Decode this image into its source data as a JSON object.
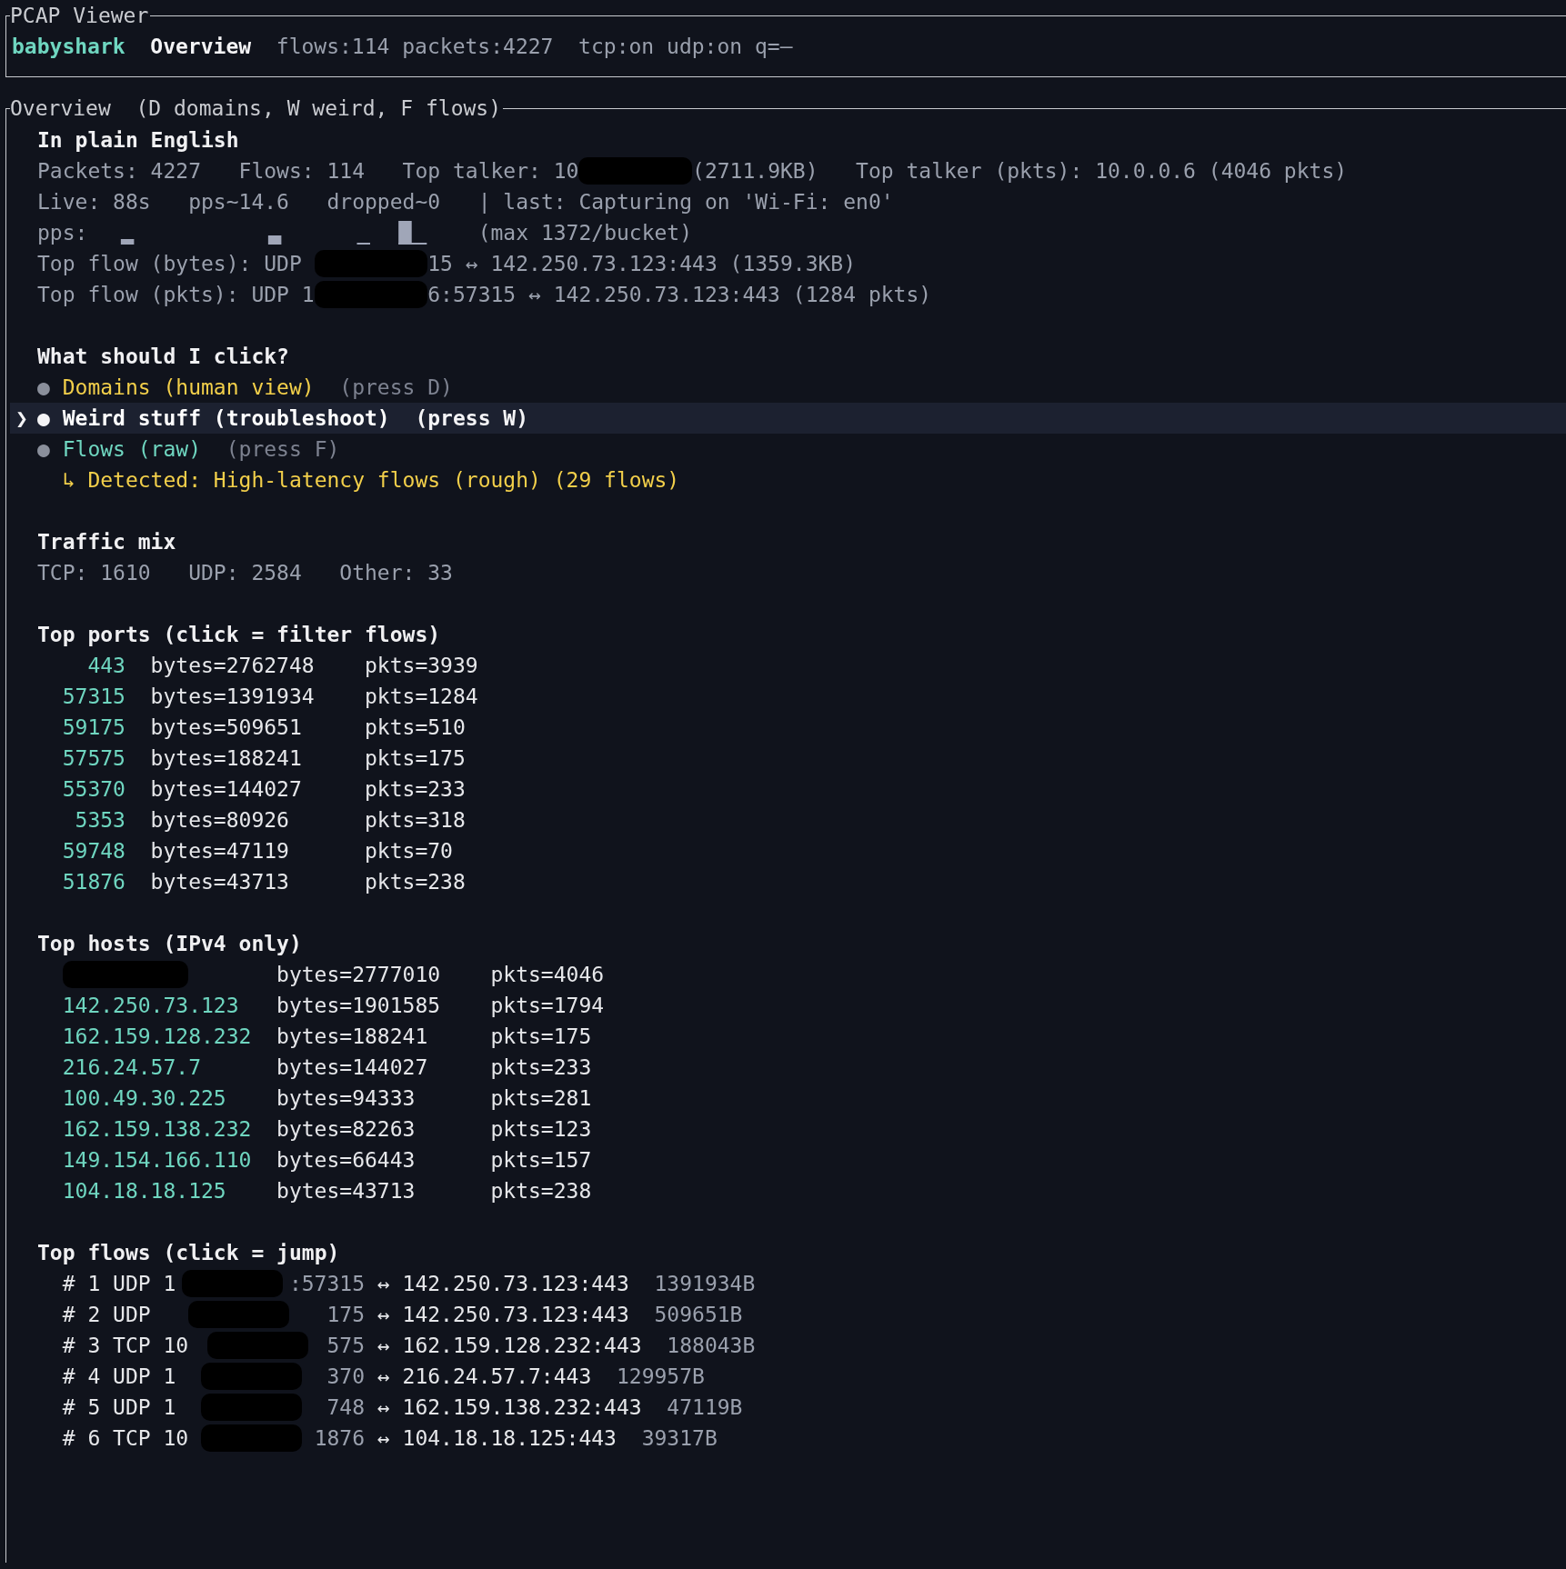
{
  "app": {
    "title": "PCAP Viewer",
    "brand": "babyshark",
    "view": "Overview",
    "status": "flows:114 packets:4227  tcp:on udp:on q=–"
  },
  "panel": {
    "title": "Overview  (D domains, W weird, F flows)"
  },
  "summary": {
    "heading": "In plain English",
    "lines": [
      [
        {
          "kind": "text",
          "text": "Packets: 4227   Flows: 114   Top talker: 10"
        },
        {
          "kind": "redacted"
        },
        {
          "kind": "text",
          "text": "(2711.9KB)   Top talker (pkts): 10.0.0.6 (4046 pkts)"
        }
      ],
      [
        {
          "kind": "text",
          "text": "Live: 88s   pps~14.6   dropped~0   | last: Capturing on 'Wi-Fi: en0'"
        }
      ],
      [
        {
          "kind": "text",
          "text": "pps: "
        },
        {
          "kind": "sparkline"
        },
        {
          "kind": "text",
          "text": "(max 1372/bucket)"
        }
      ],
      [
        {
          "kind": "text",
          "text": "Top flow (bytes): UDP "
        },
        {
          "kind": "redacted"
        },
        {
          "kind": "text",
          "text": "15 ↔ 142.250.73.123:443 (1359.3KB)"
        }
      ],
      [
        {
          "kind": "text",
          "text": "Top flow (pkts): UDP 1"
        },
        {
          "kind": "redacted"
        },
        {
          "kind": "text",
          "text": "6:57315 ↔ 142.250.73.123:443 (1284 pkts)"
        }
      ]
    ]
  },
  "click": {
    "heading": "What should I click?",
    "cursor": "❯",
    "bullet": "●",
    "items": [
      {
        "label": "Domains (human view)",
        "hint": "(press D)",
        "color": "#f2cf4a",
        "selected": false
      },
      {
        "label": "Weird stuff (troubleshoot)",
        "hint": "(press W)",
        "color": "#ffffff",
        "selected": true
      },
      {
        "label": "Flows (raw)",
        "hint": "(press F)",
        "color": "#6fd6c0",
        "selected": false
      }
    ],
    "detected": "↳ Detected: High-latency flows (rough) (29 flows)"
  },
  "traffic_mix": {
    "heading": "Traffic mix",
    "line": "TCP: 1610   UDP: 2584   Other: 33"
  },
  "top_ports": {
    "heading": "Top ports (click = filter flows)",
    "rows": [
      {
        "port": "443",
        "bytes": "bytes=2762748",
        "pkts": "pkts=3939"
      },
      {
        "port": "57315",
        "bytes": "bytes=1391934",
        "pkts": "pkts=1284"
      },
      {
        "port": "59175",
        "bytes": "bytes=509651",
        "pkts": "pkts=510"
      },
      {
        "port": "57575",
        "bytes": "bytes=188241",
        "pkts": "pkts=175"
      },
      {
        "port": "55370",
        "bytes": "bytes=144027",
        "pkts": "pkts=233"
      },
      {
        "port": "5353",
        "bytes": "bytes=80926",
        "pkts": "pkts=318"
      },
      {
        "port": "59748",
        "bytes": "bytes=47119",
        "pkts": "pkts=70"
      },
      {
        "port": "51876",
        "bytes": "bytes=43713",
        "pkts": "pkts=238"
      }
    ]
  },
  "top_hosts": {
    "heading": "Top hosts (IPv4 only)",
    "rows": [
      {
        "kind": "redacted",
        "bytes": "bytes=2777010",
        "pkts": "pkts=4046"
      },
      {
        "kind": "ip",
        "host": "142.250.73.123",
        "bytes": "bytes=1901585",
        "pkts": "pkts=1794"
      },
      {
        "kind": "ip",
        "host": "162.159.128.232",
        "bytes": "bytes=188241",
        "pkts": "pkts=175"
      },
      {
        "kind": "ip",
        "host": "216.24.57.7",
        "bytes": "bytes=144027",
        "pkts": "pkts=233"
      },
      {
        "kind": "ip",
        "host": "100.49.30.225",
        "bytes": "bytes=94333",
        "pkts": "pkts=281"
      },
      {
        "kind": "ip",
        "host": "162.159.138.232",
        "bytes": "bytes=82263",
        "pkts": "pkts=123"
      },
      {
        "kind": "ip",
        "host": "149.154.166.110",
        "bytes": "bytes=66443",
        "pkts": "pkts=157"
      },
      {
        "kind": "ip",
        "host": "104.18.18.125",
        "bytes": "bytes=43713",
        "pkts": "pkts=238"
      }
    ]
  },
  "top_flows": {
    "heading": "Top flows (click = jump)",
    "rows": [
      {
        "rank": "# 1 UDP 1",
        "src_tail": ":57315",
        "peer": "↔ 142.250.73.123:443",
        "bytes": "1391934B"
      },
      {
        "rank": "# 2 UDP",
        "src_tail": "175",
        "peer": "↔ 142.250.73.123:443",
        "bytes": "509651B"
      },
      {
        "rank": "# 3 TCP 10",
        "src_tail": "575",
        "peer": "↔ 162.159.128.232:443",
        "bytes": "188043B"
      },
      {
        "rank": "# 4 UDP 1",
        "src_tail": "370",
        "peer": "↔ 216.24.57.7:443",
        "bytes": "129957B"
      },
      {
        "rank": "# 5 UDP 1",
        "src_tail": "748",
        "peer": "↔ 162.159.138.232:443",
        "bytes": "47119B"
      },
      {
        "rank": "# 6 TCP 10",
        "src_tail": "1876",
        "peer": "↔ 104.18.18.125:443",
        "bytes": "39317B"
      }
    ]
  }
}
